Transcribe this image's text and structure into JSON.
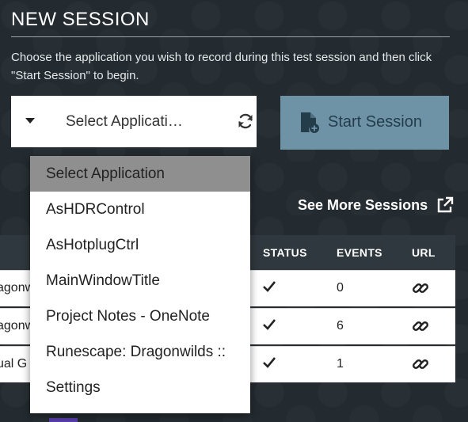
{
  "header": {
    "title": "NEW SESSION",
    "description": "Choose the application you wish to record during this test session and then click \"Start Session\" to begin."
  },
  "app_select": {
    "value": "Select Applicati…",
    "options": [
      "Select Application",
      "AsHDRControl",
      "AsHotplugCtrl",
      "MainWindowTitle",
      "Project Notes - OneNote",
      "Runescape: Dragonwilds ::",
      "Settings"
    ],
    "highlighted_index": 0
  },
  "start_button": {
    "label": "Start Session",
    "icon": "file-add-icon"
  },
  "see_more": {
    "label": "See More Sessions",
    "icon": "external-link-icon"
  },
  "table": {
    "headers": {
      "status": "STATUS",
      "events": "EVENTS",
      "url": "URL"
    },
    "rows": [
      {
        "name": "agonw",
        "status": "✓",
        "events": "0"
      },
      {
        "name": "agonw",
        "status": "✓",
        "events": "6"
      },
      {
        "name": "ual G",
        "status": "✓",
        "events": "1"
      }
    ]
  },
  "colors": {
    "background": "#232b30",
    "start_button_bg": "#6f93a6",
    "dropdown_highlight": "#8f8f8f",
    "table_header_bg": "#2f383e"
  }
}
